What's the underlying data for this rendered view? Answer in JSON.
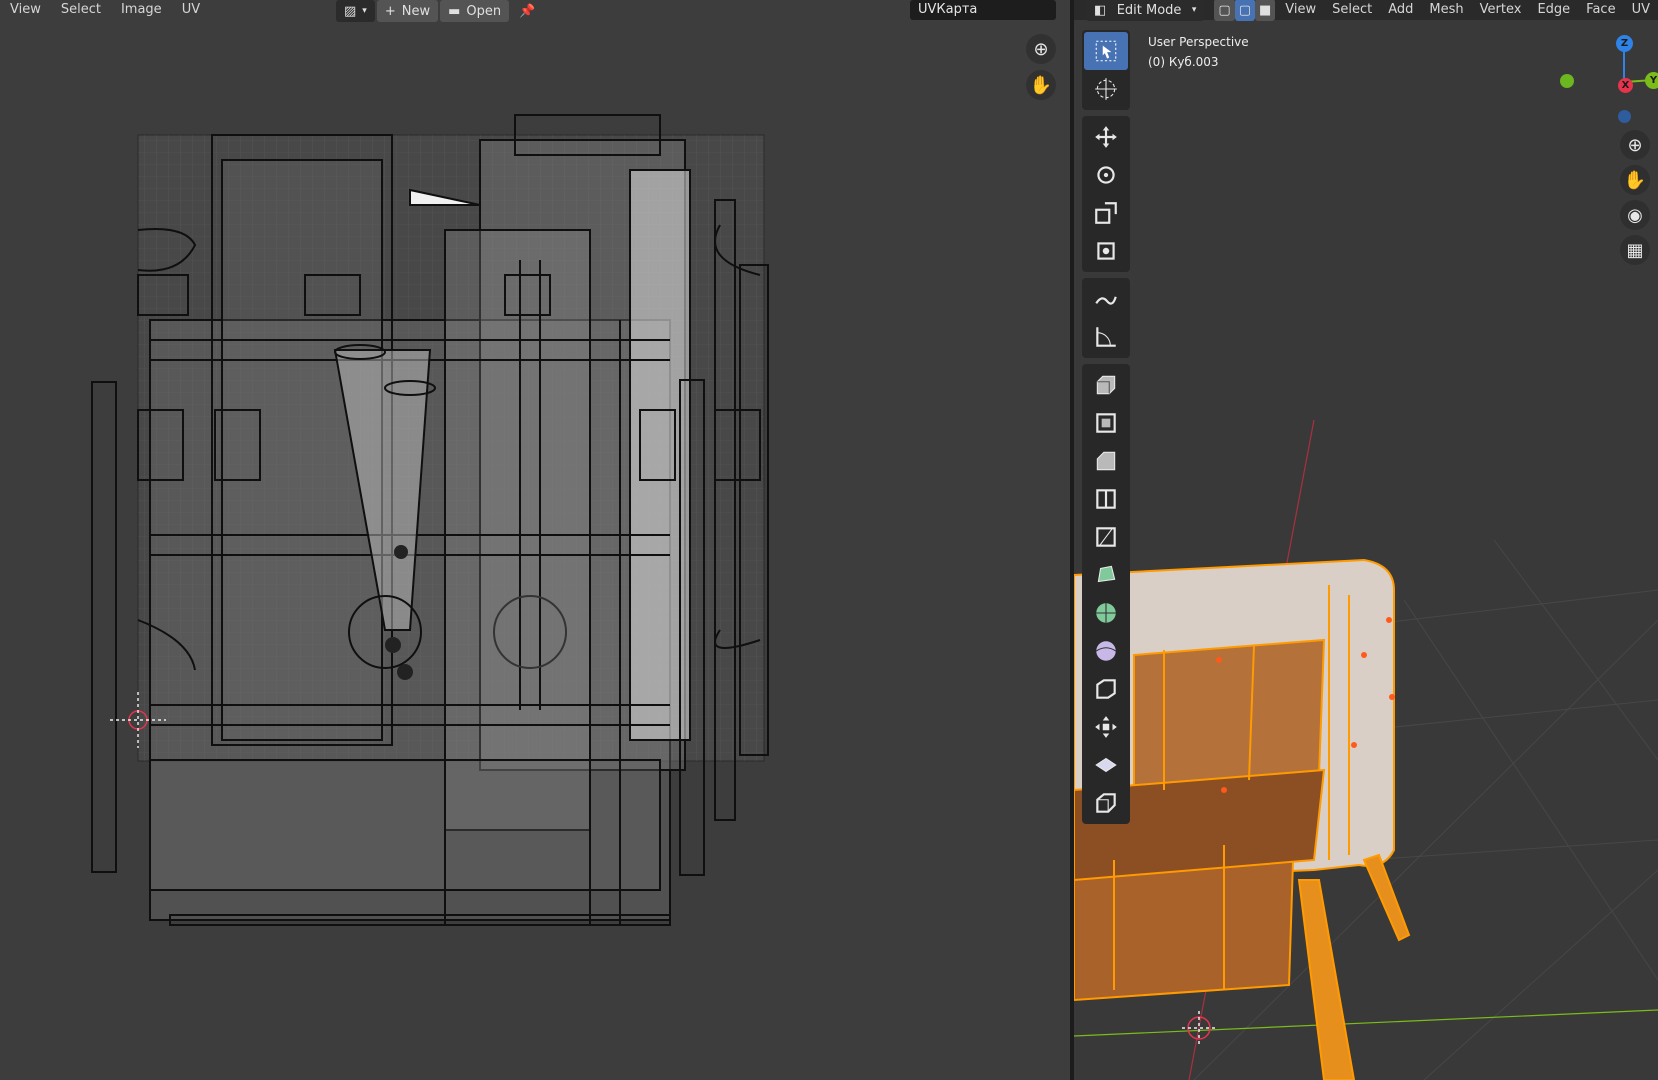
{
  "uv_editor": {
    "menu": [
      "View",
      "Select",
      "Image",
      "UV"
    ],
    "new_label": "New",
    "open_label": "Open",
    "image_name": "UVКарта"
  },
  "viewport": {
    "mode": "Edit Mode",
    "menu": [
      "View",
      "Select",
      "Add",
      "Mesh",
      "Vertex",
      "Edge",
      "Face",
      "UV"
    ],
    "perspective": "User Perspective",
    "object": "(0) Куб.003",
    "axes": {
      "z": "Z",
      "y": "Y",
      "x": "X"
    }
  },
  "colors": {
    "accent": "#4772b3",
    "selection": "#ff9a00",
    "axis_x": "#e6344d",
    "axis_y": "#7cbc1a",
    "axis_z": "#2f82e6"
  },
  "icons": {
    "tools": [
      "select-box-icon",
      "cursor-icon",
      "move-icon",
      "rotate-icon",
      "scale-icon",
      "transform-icon",
      "annotate-icon",
      "measure-icon",
      "extrude-icon",
      "inset-icon",
      "bevel-icon",
      "loop-cut-icon",
      "knife-icon",
      "poly-build-icon",
      "spin-icon",
      "smooth-icon",
      "edge-slide-icon",
      "shrink-fatten-icon",
      "shear-icon",
      "rip-icon"
    ]
  }
}
